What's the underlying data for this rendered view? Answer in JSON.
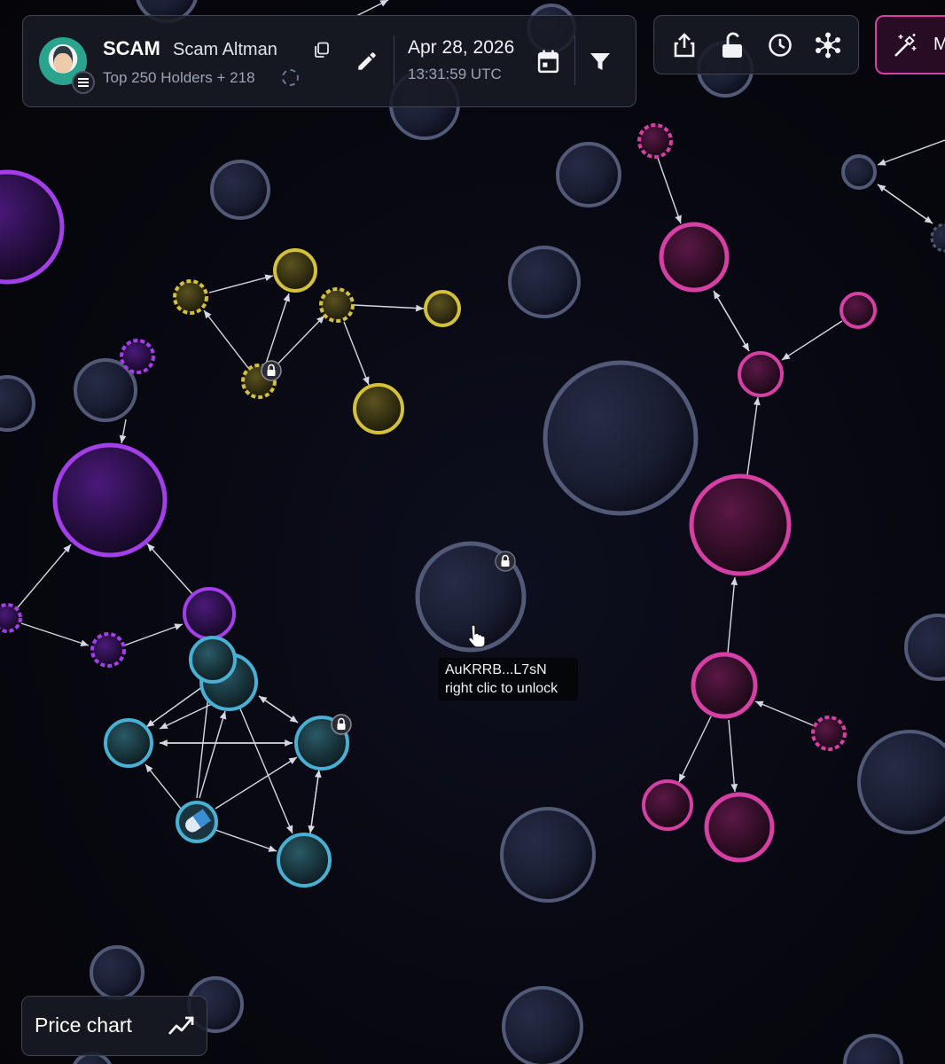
{
  "token": {
    "symbol": "SCAM",
    "name": "Scam Altman",
    "holders_label": "Top 250 Holders + 218",
    "chain_icon": "solana-icon",
    "avatar_icon": "token-avatar-icon"
  },
  "snapshot": {
    "date": "Apr 28, 2026",
    "time": "13:31:59 UTC"
  },
  "header_icons": [
    "copy-icon",
    "edit-icon",
    "calendar-icon",
    "filter-icon"
  ],
  "toolbar": {
    "tools": [
      "share-icon",
      "unlock-icon",
      "history-icon",
      "network-icon"
    ]
  },
  "magic_button": {
    "label": "M",
    "icon": "magic-wand-icon"
  },
  "tooltip": {
    "address": "AuKRRB...L7sN",
    "hint": "right clic to unlock"
  },
  "price_chart_button": {
    "label": "Price chart",
    "icon": "trend-line-icon"
  },
  "colors": {
    "background": "#07070f",
    "panel": "#181a24",
    "accent_pink": "#d63fa4",
    "cluster_purple": "#a23fe8",
    "cluster_yellow": "#d3c03c",
    "cluster_cyan": "#4ab0d3",
    "neutral_node": "#525a78"
  }
}
